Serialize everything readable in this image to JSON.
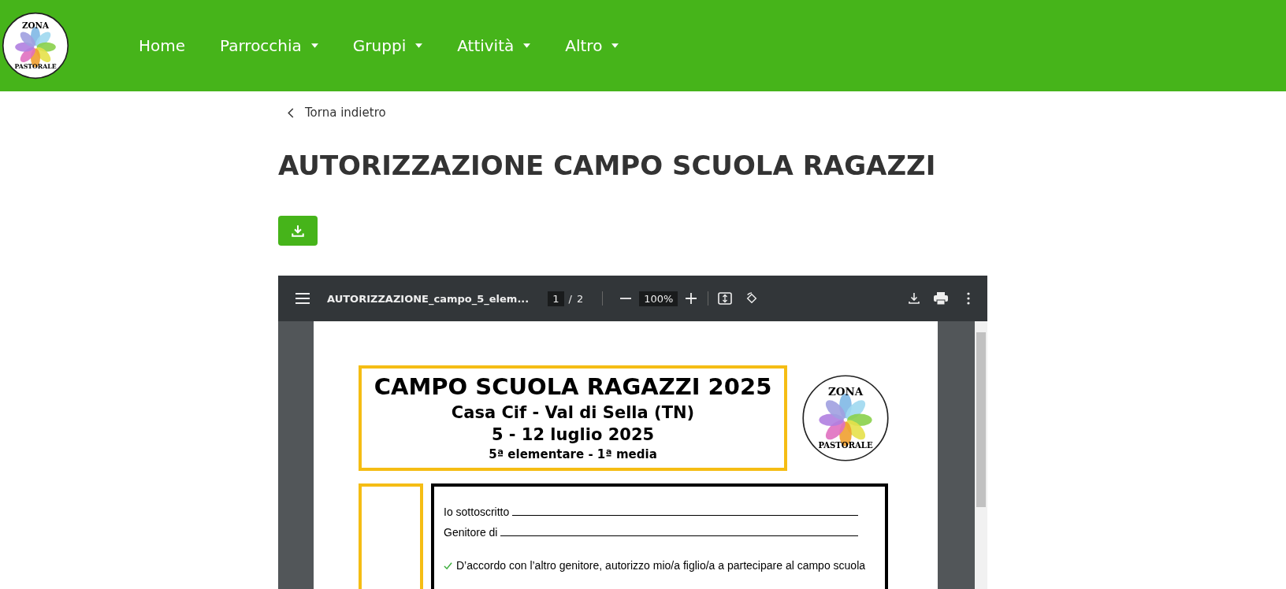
{
  "header": {
    "logo": {
      "top": "ZONA",
      "bottom": "PASTORALE"
    },
    "nav": [
      {
        "label": "Home",
        "dropdown": false
      },
      {
        "label": "Parrocchia",
        "dropdown": true
      },
      {
        "label": "Gruppi",
        "dropdown": true
      },
      {
        "label": "Attività",
        "dropdown": true
      },
      {
        "label": "Altro",
        "dropdown": true
      }
    ]
  },
  "back_link": "Torna indietro",
  "title": "AUTORIZZAZIONE CAMPO SCUOLA RAGAZZI",
  "pdf_viewer": {
    "file_name": "AUTORIZZAZIONE_campo_5_elem...",
    "page": "1",
    "page_separator": "/",
    "page_count": "2",
    "zoom": "100%",
    "document": {
      "heading": {
        "title": "CAMPO SCUOLA RAGAZZI 2025",
        "place": "Casa Cif - Val di Sella (TN)",
        "dates": "5 - 12 luglio 2025",
        "classes": "5ª elementare - 1ª media"
      },
      "logo": {
        "top": "ZONA",
        "bottom": "PASTORALE"
      },
      "fields": [
        {
          "label": "Io sottoscritto"
        },
        {
          "label": "Genitore di"
        }
      ],
      "statements": [
        {
          "text": "D’accordo con l’altro genitore, autorizzo mio/a figlio/a a partecipare al campo scuola",
          "checked": true
        }
      ]
    }
  }
}
